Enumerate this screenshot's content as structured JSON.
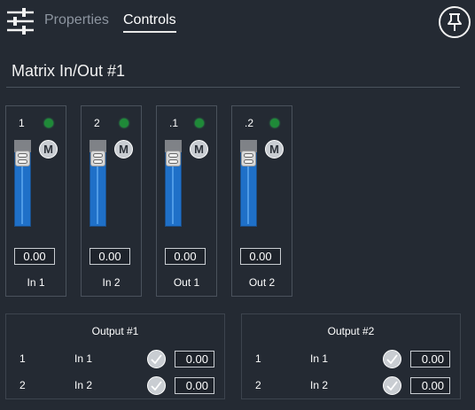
{
  "tabs": {
    "properties": "Properties",
    "controls": "Controls"
  },
  "icons": {
    "menu": "mixer-sliders-icon",
    "pin": "pushpin-icon",
    "mute": "mute-icon",
    "check": "checkmark-icon"
  },
  "colors": {
    "background": "#242a33",
    "fader_fill": "#1f70c8",
    "led_active": "#1f8a38",
    "border": "#4a525c"
  },
  "section": {
    "title": "Matrix In/Out #1"
  },
  "strips": [
    {
      "number": "1",
      "mute_label": "M",
      "value": "0.00",
      "name": "In 1"
    },
    {
      "number": "2",
      "mute_label": "M",
      "value": "0.00",
      "name": "In 2"
    },
    {
      "number": ".1",
      "mute_label": "M",
      "value": "0.00",
      "name": "Out 1"
    },
    {
      "number": ".2",
      "mute_label": "M",
      "value": "0.00",
      "name": "Out 2"
    }
  ],
  "outputs": [
    {
      "title": "Output #1",
      "rows": [
        {
          "index": "1",
          "input": "In 1",
          "value": "0.00"
        },
        {
          "index": "2",
          "input": "In 2",
          "value": "0.00"
        }
      ]
    },
    {
      "title": "Output #2",
      "rows": [
        {
          "index": "1",
          "input": "In 1",
          "value": "0.00"
        },
        {
          "index": "2",
          "input": "In 2",
          "value": "0.00"
        }
      ]
    }
  ]
}
